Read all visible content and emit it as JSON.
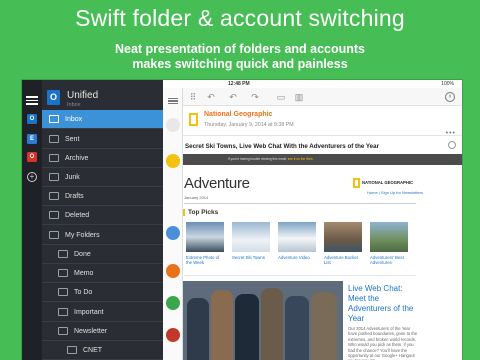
{
  "hero": {
    "title": "Swift folder & account switching",
    "subtitle_line1": "Neat presentation of folders and accounts",
    "subtitle_line2": "makes switching quick and painless"
  },
  "status": {
    "time": "12:48 PM",
    "battery": "100%"
  },
  "accounts": {
    "outlook_letter": "O",
    "exchange_letter": "E",
    "office_letter": "O",
    "add": "+"
  },
  "folder_panel": {
    "title": "Unified",
    "subtitle": "Inbox",
    "header_icon_letter": "O",
    "items": [
      {
        "label": "Inbox",
        "selected": true
      },
      {
        "label": "Sent"
      },
      {
        "label": "Archive"
      },
      {
        "label": "Junk"
      },
      {
        "label": "Drafts"
      },
      {
        "label": "Deleted"
      },
      {
        "label": "My Folders"
      },
      {
        "label": "Done"
      },
      {
        "label": "Memo"
      },
      {
        "label": "To Do"
      },
      {
        "label": "Important"
      },
      {
        "label": "Newsletter"
      },
      {
        "label": "CNET"
      }
    ]
  },
  "message": {
    "sender": "National Geographic",
    "date": "Thursday, January 9, 2014 at 9:38 PM",
    "subject": "Secret Ski Towns, Live Web Chat With the Adventurers of the Year",
    "banner_text": "If you're having trouble viewing this email, ",
    "banner_link": "see it on the Web.",
    "newsletter_title": "Adventure",
    "newsletter_date": "January 2014",
    "brand": "NATIONAL GEOGRAPHIC",
    "brand_links": "Home | Sign Up for Newsletters",
    "section": "Top Picks",
    "picks": [
      {
        "caption": "Extreme Photo of the Week"
      },
      {
        "caption": "Secret Ski Towns"
      },
      {
        "caption": "Adventure Video"
      },
      {
        "caption": "Adventure Bucket List"
      },
      {
        "caption": "Adventurers' Best Adventures"
      }
    ],
    "live_title": "Live Web Chat: Meet the Adventurers of the Year",
    "live_body": "Our 2014 Adventurers of the Year have pushed boundaries, gone to the extremes, and broken world records. Who would you pick as them, if you had the chance? You'll have the opportunity at our Google+ Hangout on January 13"
  },
  "colors": {
    "background": "#46bd55",
    "accent": "#3b92d6",
    "brand_yellow": "#f2c20f",
    "sender_orange": "#e9731c"
  },
  "icons": [
    "menu-icon",
    "outlook-icon",
    "exchange-icon",
    "office-icon",
    "add-icon",
    "inbox-icon",
    "sent-icon",
    "archive-icon",
    "junk-icon",
    "drafts-icon",
    "trash-icon",
    "folder-icon",
    "reply-icon",
    "reply-all-icon",
    "forward-icon",
    "move-icon",
    "delete-icon",
    "back-icon",
    "next-icon"
  ]
}
